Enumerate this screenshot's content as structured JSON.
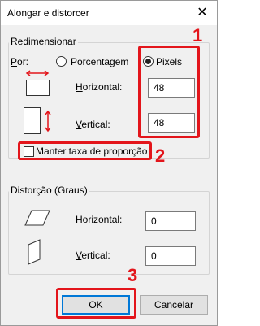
{
  "window": {
    "title": "Alongar e distorcer",
    "close_glyph": "✕"
  },
  "resize": {
    "group_label": "Redimensionar",
    "por_label": "Por:",
    "percent_label": "Porcentagem",
    "pixels_label": "Pixels",
    "selected_unit": "Pixels",
    "horizontal_label": "Horizontal:",
    "horizontal_value": "48",
    "vertical_label": "Vertical:",
    "vertical_value": "48",
    "keep_ratio_label": "Manter taxa de proporção",
    "keep_ratio_checked": false
  },
  "skew": {
    "group_label": "Distorção (Graus)",
    "horizontal_label": "Horizontal:",
    "horizontal_value": "0",
    "vertical_label": "Vertical:",
    "vertical_value": "0"
  },
  "buttons": {
    "ok_label": "OK",
    "cancel_label": "Cancelar"
  },
  "annotations": {
    "marker_1": "1",
    "marker_2": "2",
    "marker_3": "3",
    "marker_color": "#e3151b"
  },
  "icons": {
    "horizontal_resize": "horizontal-resize-icon",
    "vertical_resize": "vertical-resize-icon",
    "horizontal_skew": "horizontal-skew-icon",
    "vertical_skew": "vertical-skew-icon"
  }
}
